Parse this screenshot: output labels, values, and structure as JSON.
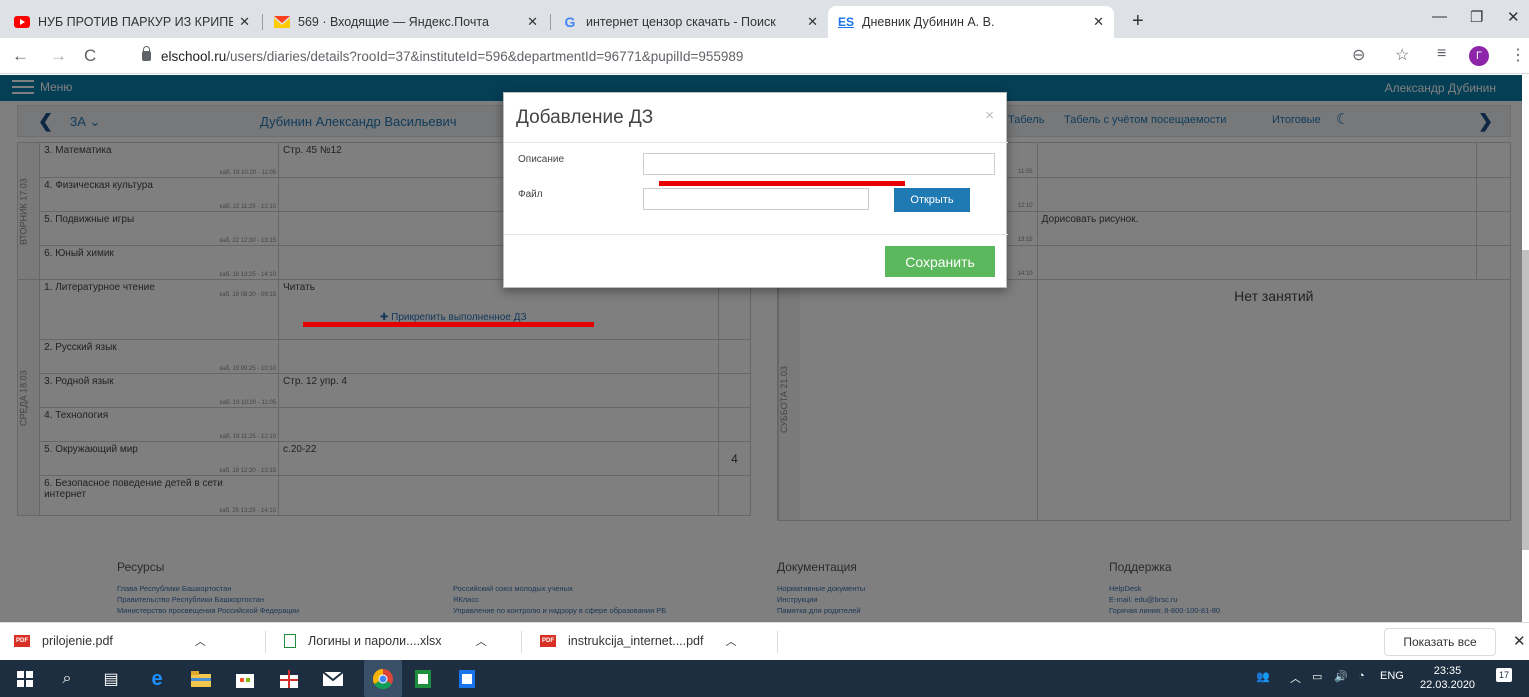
{
  "browser": {
    "tabs": [
      {
        "title": "НУБ ПРОТИВ ПАРКУР ИЗ КРИПЕ",
        "icon": "youtube-icon"
      },
      {
        "title": "569 · Входящие — Яндекс.Почта",
        "icon": "yandex-mail-icon"
      },
      {
        "title": "интернет цензор скачать - Поиск",
        "icon": "google-icon"
      },
      {
        "title": "Дневник Дубинин А. В.",
        "icon": "elschool-icon",
        "favicon_text": "ES"
      }
    ],
    "url_host": "elschool.ru",
    "url_path": "/users/diaries/details?rooId=37&instituteId=596&departmentId=96771&pupilId=955989",
    "profile_initial": "Г"
  },
  "site": {
    "menu_label": "Меню",
    "user_name": "Александр Дубинин",
    "class_label": "3А",
    "pupil_name": "Дубинин Александр Васильевич",
    "nav_links": [
      "Табель",
      "Табель с учётом посещаемости",
      "Итоговые"
    ]
  },
  "diary": {
    "tuesday": {
      "label": "ВТОРНИК 17.03",
      "lessons": [
        {
          "subject": "3. Математика",
          "cab": "каб. 19  10:20 - 11:05",
          "hw": "Стр. 45 №12"
        },
        {
          "subject": "4. Физическая культура",
          "cab": "каб. 22  11:25 - 12:10",
          "hw": ""
        },
        {
          "subject": "5. Подвижные игры",
          "cab": "каб. 22  12:30 - 13:15",
          "hw": ""
        },
        {
          "subject": "6. Юный химик",
          "cab": "каб. 18  13:25 - 14:10",
          "hw": ""
        }
      ]
    },
    "wednesday": {
      "label": "СРЕДА 18.03",
      "lessons": [
        {
          "subject": "1. Литературное чтение",
          "cab": "каб. 19  08:30 - 09:15",
          "hw": "Читать",
          "grade": ""
        },
        {
          "subject": "2. Русский язык",
          "cab": "каб. 19  09:25 - 10:10",
          "hw": "",
          "grade": ""
        },
        {
          "subject": "3. Родной язык",
          "cab": "каб. 19  10:20 - 11:05",
          "hw": "Стр. 12 упр. 4",
          "grade": ""
        },
        {
          "subject": "4. Технология",
          "cab": "каб. 19  11:25 - 12:10",
          "hw": "",
          "grade": ""
        },
        {
          "subject": "5. Окружающий мир",
          "cab": "каб. 19  12:30 - 13:15",
          "hw": "с.20-22",
          "grade": "4"
        },
        {
          "subject": "6. Безопасное поведение детей в сети интернет",
          "cab": "каб. 25  13:25 - 14:10",
          "hw": "",
          "grade": ""
        }
      ]
    },
    "attach_label": "✚ Прикрепить выполненное ДЗ",
    "right_times": [
      "11:05",
      "12:10",
      "13:15",
      "14:10"
    ],
    "right_hw_5": "Дорисовать рисунок.",
    "saturday": {
      "label": "СУББОТА 21.03",
      "no_lessons": "Нет занятий"
    }
  },
  "footer": {
    "resources": {
      "title": "Ресурсы",
      "links": [
        "Глава Республики Башкортостан",
        "Правительство Республики Башкортостан",
        "Министерство просвещения Российской Федерации"
      ]
    },
    "resources2": [
      "Российский союз молодых ученых",
      "ЯКласс",
      "Управление по контролю и надзору в сфере образования РБ"
    ],
    "docs": {
      "title": "Документация",
      "links": [
        "Нормативные документы",
        "Инструкции",
        "Памятка для родителей"
      ]
    },
    "support": {
      "title": "Поддержка",
      "links": [
        "HelpDesk",
        "E-mail: edu@brsc.ru",
        "Горячая линия: 8-800-100-81-80"
      ]
    }
  },
  "modal": {
    "title": "Добавление ДЗ",
    "close": "×",
    "description_label": "Описание",
    "description_value": "",
    "file_label": "Файл",
    "file_value": "",
    "open_button": "Открыть",
    "save_button": "Сохранить"
  },
  "downloads": {
    "items": [
      {
        "name": "prilojenie.pdf",
        "type": "pdf"
      },
      {
        "name": "Логины и пароли....xlsx",
        "type": "xlsx"
      },
      {
        "name": "instrukcija_internet....pdf",
        "type": "pdf"
      }
    ],
    "show_all": "Показать все"
  },
  "taskbar": {
    "lang": "ENG",
    "time": "23:35",
    "date": "22.03.2020",
    "notifications": "17"
  },
  "colors": {
    "accent": "#0b7fad",
    "save": "#5cb85c",
    "open": "#1f7ab4",
    "annotation": "#e60000"
  }
}
